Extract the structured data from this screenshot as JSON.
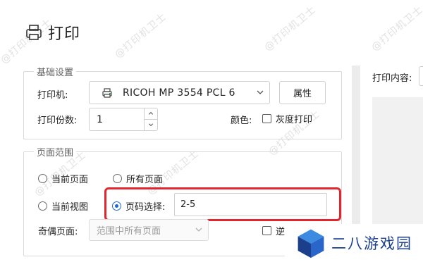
{
  "dialog": {
    "title": "打印"
  },
  "basic_settings": {
    "legend": "基础设置",
    "printer_label": "打印机:",
    "printer_value": "RICOH MP 3554 PCL 6",
    "properties_button": "属性",
    "copies_label": "打印份数:",
    "copies_value": "1",
    "color_label": "颜色:",
    "grayscale_label": "灰度打印"
  },
  "page_range": {
    "legend": "页面范围",
    "current_page": "当前页面",
    "all_pages": "所有页面",
    "current_view": "当前视图",
    "page_selection_label": "页码选择:",
    "page_selection_value": "2-5",
    "odd_even_label": "奇偶页面:",
    "odd_even_value": "范围中所有页面",
    "reverse_label_partial": "逆序打印",
    "selected": "page_selection"
  },
  "preview": {
    "content_label": "打印内容:"
  },
  "watermark_text": "@打印机卫士",
  "logo": {
    "text": "二八游戏园"
  },
  "colors": {
    "accent": "#1967d2",
    "highlight": "#e0262f",
    "brand": "#1c3f8b"
  }
}
